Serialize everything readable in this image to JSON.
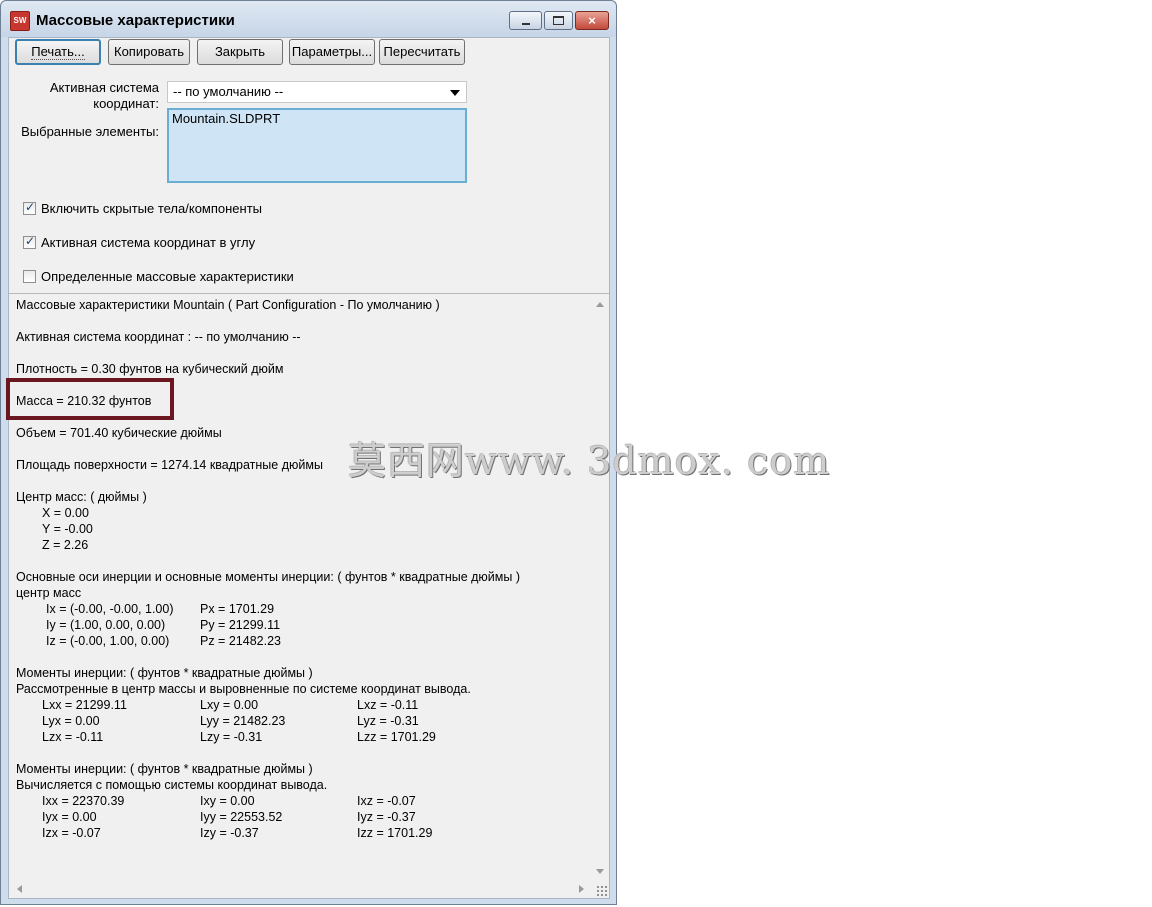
{
  "window": {
    "title": "Массовые характеристики",
    "app_icon": "SW",
    "controls": {
      "minimize": "minimize-icon",
      "maximize": "maximize-icon",
      "close": "×"
    }
  },
  "toolbar": {
    "print": "Печать...",
    "copy": "Копировать",
    "close": "Закрыть",
    "options": "Параметры...",
    "recalculate": "Пересчитать"
  },
  "coord_system": {
    "label_line1": "Активная система",
    "label_line2": "координат:",
    "value": "-- по умолчанию --"
  },
  "selected": {
    "label": "Выбранные элементы:",
    "items": [
      "Mountain.SLDPRT"
    ]
  },
  "checkboxes": [
    {
      "label": "Включить скрытые тела/компоненты",
      "checked": true
    },
    {
      "label": "Активная система координат в углу",
      "checked": true
    },
    {
      "label": "Определенные массовые характеристики",
      "checked": false
    }
  ],
  "results": {
    "header": "Массовые характеристики Mountain ( Part Configuration - По умолчанию )",
    "coord": "Активная система координат : -- по умолчанию --",
    "density": "Плотность = 0.30 фунтов на кубический дюйм",
    "mass": "Масса = 210.32 фунтов",
    "volume": "Объем = 701.40 кубические дюймы",
    "surface": "Площадь поверхности = 1274.14 квадратные дюймы",
    "com_title": "Центр масс: ( дюймы )",
    "com_x": "X = 0.00",
    "com_y": "Y = -0.00",
    "com_z": "Z = 2.26",
    "principal_title": "Основные оси инерции и основные моменты инерции: ( фунтов * квадратные дюймы )",
    "principal_sub": "центр масс",
    "principal_rows": [
      {
        "axis": "Ix = (-0.00, -0.00, 1.00)",
        "moment": "Px = 1701.29"
      },
      {
        "axis": "Iy = (1.00, 0.00, 0.00)",
        "moment": "Py = 21299.11"
      },
      {
        "axis": "Iz = (-0.00, 1.00, 0.00)",
        "moment": "Pz = 21482.23"
      }
    ],
    "moments1_title": "Моменты инерции: ( фунтов * квадратные дюймы )",
    "moments1_sub": "Рассмотренные в центр массы и выровненные по системе координат вывода.",
    "moments1_rows": [
      [
        "Lxx = 21299.11",
        "Lxy = 0.00",
        "Lxz = -0.11"
      ],
      [
        "Lyx = 0.00",
        "Lyy = 21482.23",
        "Lyz = -0.31"
      ],
      [
        "Lzx = -0.11",
        "Lzy = -0.31",
        "Lzz = 1701.29"
      ]
    ],
    "moments2_title": "Моменты инерции: ( фунтов * квадратные дюймы )",
    "moments2_sub": "Вычисляется с помощью системы координат вывода.",
    "moments2_rows": [
      [
        "Ixx = 22370.39",
        "Ixy = 0.00",
        "Ixz = -0.07"
      ],
      [
        "Iyx = 0.00",
        "Iyy = 22553.52",
        "Iyz = -0.37"
      ],
      [
        "Izx = -0.07",
        "Izy = -0.37",
        "Izz = 1701.29"
      ]
    ]
  },
  "watermark": "莫西网www. 3dmox. com"
}
